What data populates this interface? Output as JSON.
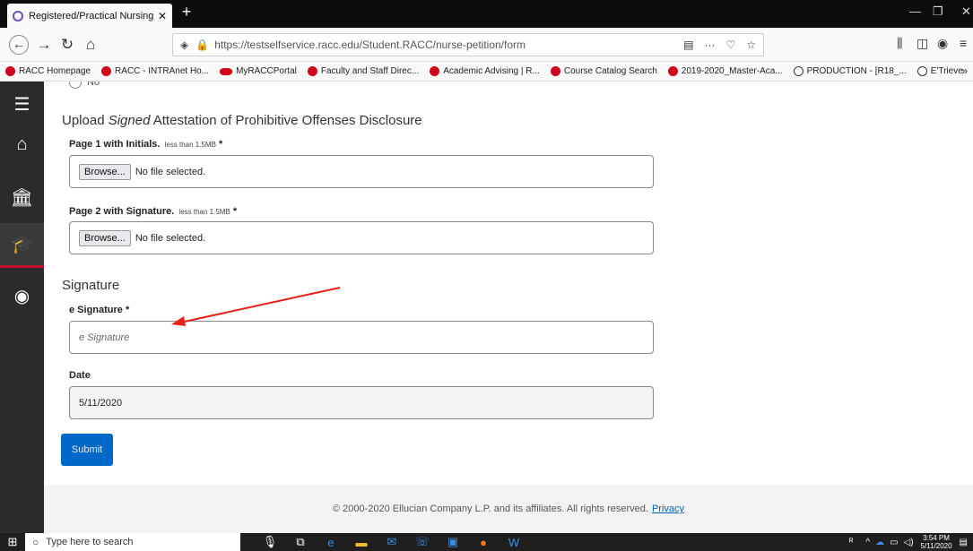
{
  "browser": {
    "tab_title": "Registered/Practical Nursing Pe",
    "tab_close": "✕",
    "new_tab": "+",
    "url": "https://testselfservice.racc.edu/Student.RACC/nurse-petition/form",
    "url_actions": "···"
  },
  "bookmarks": [
    {
      "label": "RACC Homepage",
      "icon": "racc-logo"
    },
    {
      "label": "RACC - INTRAnet Ho...",
      "icon": "racc-logo"
    },
    {
      "label": "MyRACCPortal",
      "icon": "portal-logo"
    },
    {
      "label": "Faculty and Staff Direc...",
      "icon": "racc-logo"
    },
    {
      "label": "Academic Advising | R...",
      "icon": "racc-logo"
    },
    {
      "label": "Course Catalog Search",
      "icon": "racc-logo"
    },
    {
      "label": "2019-2020_Master-Aca...",
      "icon": "racc-logo"
    },
    {
      "label": "PRODUCTION - [R18_...",
      "icon": "globe"
    },
    {
      "label": "E'Trieve",
      "icon": "globe"
    }
  ],
  "form": {
    "prev_radio_label": "No",
    "upload_section": {
      "title_pre": "Upload ",
      "title_em": "Signed",
      "title_post": " Attestation of Prohibitive Offenses Disclosure",
      "page1_label": "Page 1 with Initials.",
      "page2_label": "Page 2 with Signature.",
      "size_hint": "less than 1.5MB",
      "required_mark": "*",
      "browse_label": "Browse...",
      "no_file_text": "No file selected."
    },
    "signature_section": {
      "title": "Signature",
      "esig_label": "e Signature *",
      "esig_placeholder": "e Signature",
      "date_label": "Date",
      "date_value": "5/11/2020"
    },
    "submit_label": "Submit"
  },
  "footer": {
    "copyright": "© 2000-2020 Ellucian Company L.P. and its affiliates. All rights reserved.",
    "privacy_link": "Privacy"
  },
  "taskbar": {
    "search_placeholder": "Type here to search",
    "time": "3:54 PM",
    "date": "5/11/2020"
  },
  "colors": {
    "accent_red": "#c8102e",
    "submit_blue": "#0068c8",
    "annotation_arrow": "#e8201a"
  }
}
